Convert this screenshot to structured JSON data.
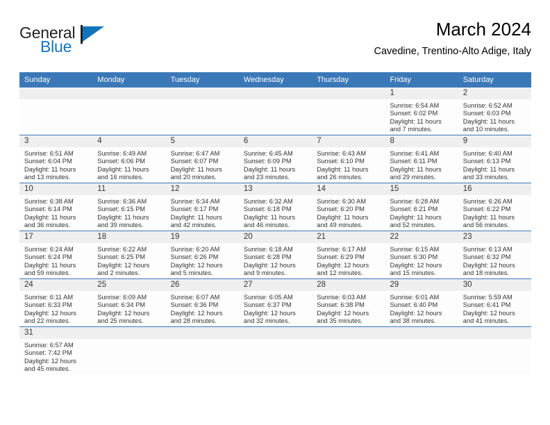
{
  "brand": {
    "name_part1": "General",
    "name_part2": "Blue",
    "mark": "triangle-logo"
  },
  "header": {
    "title": "March 2024",
    "subtitle": "Cavedine, Trentino-Alto Adige, Italy"
  },
  "colors": {
    "header_blue": "#3b78b8",
    "brand_blue": "#1175bb",
    "daynum_band": "#efefef",
    "text": "#333333"
  },
  "weekday_headers": [
    "Sunday",
    "Monday",
    "Tuesday",
    "Wednesday",
    "Thursday",
    "Friday",
    "Saturday"
  ],
  "labels": {
    "sunrise": "Sunrise:",
    "sunset": "Sunset:",
    "daylight": "Daylight:"
  },
  "weeks": [
    [
      {
        "day": "",
        "empty": true
      },
      {
        "day": "",
        "empty": true
      },
      {
        "day": "",
        "empty": true
      },
      {
        "day": "",
        "empty": true
      },
      {
        "day": "",
        "empty": true
      },
      {
        "day": "1",
        "sunrise": "Sunrise: 6:54 AM",
        "sunset": "Sunset: 6:02 PM",
        "daylight_1": "Daylight: 11 hours",
        "daylight_2": "and 7 minutes."
      },
      {
        "day": "2",
        "sunrise": "Sunrise: 6:52 AM",
        "sunset": "Sunset: 6:03 PM",
        "daylight_1": "Daylight: 11 hours",
        "daylight_2": "and 10 minutes."
      }
    ],
    [
      {
        "day": "3",
        "sunrise": "Sunrise: 6:51 AM",
        "sunset": "Sunset: 6:04 PM",
        "daylight_1": "Daylight: 11 hours",
        "daylight_2": "and 13 minutes."
      },
      {
        "day": "4",
        "sunrise": "Sunrise: 6:49 AM",
        "sunset": "Sunset: 6:06 PM",
        "daylight_1": "Daylight: 11 hours",
        "daylight_2": "and 16 minutes."
      },
      {
        "day": "5",
        "sunrise": "Sunrise: 6:47 AM",
        "sunset": "Sunset: 6:07 PM",
        "daylight_1": "Daylight: 11 hours",
        "daylight_2": "and 20 minutes."
      },
      {
        "day": "6",
        "sunrise": "Sunrise: 6:45 AM",
        "sunset": "Sunset: 6:09 PM",
        "daylight_1": "Daylight: 11 hours",
        "daylight_2": "and 23 minutes."
      },
      {
        "day": "7",
        "sunrise": "Sunrise: 6:43 AM",
        "sunset": "Sunset: 6:10 PM",
        "daylight_1": "Daylight: 11 hours",
        "daylight_2": "and 26 minutes."
      },
      {
        "day": "8",
        "sunrise": "Sunrise: 6:41 AM",
        "sunset": "Sunset: 6:11 PM",
        "daylight_1": "Daylight: 11 hours",
        "daylight_2": "and 29 minutes."
      },
      {
        "day": "9",
        "sunrise": "Sunrise: 6:40 AM",
        "sunset": "Sunset: 6:13 PM",
        "daylight_1": "Daylight: 11 hours",
        "daylight_2": "and 33 minutes."
      }
    ],
    [
      {
        "day": "10",
        "sunrise": "Sunrise: 6:38 AM",
        "sunset": "Sunset: 6:14 PM",
        "daylight_1": "Daylight: 11 hours",
        "daylight_2": "and 36 minutes."
      },
      {
        "day": "11",
        "sunrise": "Sunrise: 6:36 AM",
        "sunset": "Sunset: 6:15 PM",
        "daylight_1": "Daylight: 11 hours",
        "daylight_2": "and 39 minutes."
      },
      {
        "day": "12",
        "sunrise": "Sunrise: 6:34 AM",
        "sunset": "Sunset: 6:17 PM",
        "daylight_1": "Daylight: 11 hours",
        "daylight_2": "and 42 minutes."
      },
      {
        "day": "13",
        "sunrise": "Sunrise: 6:32 AM",
        "sunset": "Sunset: 6:18 PM",
        "daylight_1": "Daylight: 11 hours",
        "daylight_2": "and 46 minutes."
      },
      {
        "day": "14",
        "sunrise": "Sunrise: 6:30 AM",
        "sunset": "Sunset: 6:20 PM",
        "daylight_1": "Daylight: 11 hours",
        "daylight_2": "and 49 minutes."
      },
      {
        "day": "15",
        "sunrise": "Sunrise: 6:28 AM",
        "sunset": "Sunset: 6:21 PM",
        "daylight_1": "Daylight: 11 hours",
        "daylight_2": "and 52 minutes."
      },
      {
        "day": "16",
        "sunrise": "Sunrise: 6:26 AM",
        "sunset": "Sunset: 6:22 PM",
        "daylight_1": "Daylight: 11 hours",
        "daylight_2": "and 56 minutes."
      }
    ],
    [
      {
        "day": "17",
        "sunrise": "Sunrise: 6:24 AM",
        "sunset": "Sunset: 6:24 PM",
        "daylight_1": "Daylight: 11 hours",
        "daylight_2": "and 59 minutes."
      },
      {
        "day": "18",
        "sunrise": "Sunrise: 6:22 AM",
        "sunset": "Sunset: 6:25 PM",
        "daylight_1": "Daylight: 12 hours",
        "daylight_2": "and 2 minutes."
      },
      {
        "day": "19",
        "sunrise": "Sunrise: 6:20 AM",
        "sunset": "Sunset: 6:26 PM",
        "daylight_1": "Daylight: 12 hours",
        "daylight_2": "and 5 minutes."
      },
      {
        "day": "20",
        "sunrise": "Sunrise: 6:18 AM",
        "sunset": "Sunset: 6:28 PM",
        "daylight_1": "Daylight: 12 hours",
        "daylight_2": "and 9 minutes."
      },
      {
        "day": "21",
        "sunrise": "Sunrise: 6:17 AM",
        "sunset": "Sunset: 6:29 PM",
        "daylight_1": "Daylight: 12 hours",
        "daylight_2": "and 12 minutes."
      },
      {
        "day": "22",
        "sunrise": "Sunrise: 6:15 AM",
        "sunset": "Sunset: 6:30 PM",
        "daylight_1": "Daylight: 12 hours",
        "daylight_2": "and 15 minutes."
      },
      {
        "day": "23",
        "sunrise": "Sunrise: 6:13 AM",
        "sunset": "Sunset: 6:32 PM",
        "daylight_1": "Daylight: 12 hours",
        "daylight_2": "and 18 minutes."
      }
    ],
    [
      {
        "day": "24",
        "sunrise": "Sunrise: 6:11 AM",
        "sunset": "Sunset: 6:33 PM",
        "daylight_1": "Daylight: 12 hours",
        "daylight_2": "and 22 minutes."
      },
      {
        "day": "25",
        "sunrise": "Sunrise: 6:09 AM",
        "sunset": "Sunset: 6:34 PM",
        "daylight_1": "Daylight: 12 hours",
        "daylight_2": "and 25 minutes."
      },
      {
        "day": "26",
        "sunrise": "Sunrise: 6:07 AM",
        "sunset": "Sunset: 6:36 PM",
        "daylight_1": "Daylight: 12 hours",
        "daylight_2": "and 28 minutes."
      },
      {
        "day": "27",
        "sunrise": "Sunrise: 6:05 AM",
        "sunset": "Sunset: 6:37 PM",
        "daylight_1": "Daylight: 12 hours",
        "daylight_2": "and 32 minutes."
      },
      {
        "day": "28",
        "sunrise": "Sunrise: 6:03 AM",
        "sunset": "Sunset: 6:38 PM",
        "daylight_1": "Daylight: 12 hours",
        "daylight_2": "and 35 minutes."
      },
      {
        "day": "29",
        "sunrise": "Sunrise: 6:01 AM",
        "sunset": "Sunset: 6:40 PM",
        "daylight_1": "Daylight: 12 hours",
        "daylight_2": "and 38 minutes."
      },
      {
        "day": "30",
        "sunrise": "Sunrise: 5:59 AM",
        "sunset": "Sunset: 6:41 PM",
        "daylight_1": "Daylight: 12 hours",
        "daylight_2": "and 41 minutes."
      }
    ],
    [
      {
        "day": "31",
        "sunrise": "Sunrise: 6:57 AM",
        "sunset": "Sunset: 7:42 PM",
        "daylight_1": "Daylight: 12 hours",
        "daylight_2": "and 45 minutes."
      },
      {
        "day": "",
        "empty": true
      },
      {
        "day": "",
        "empty": true
      },
      {
        "day": "",
        "empty": true
      },
      {
        "day": "",
        "empty": true
      },
      {
        "day": "",
        "empty": true
      },
      {
        "day": "",
        "empty": true
      }
    ]
  ]
}
